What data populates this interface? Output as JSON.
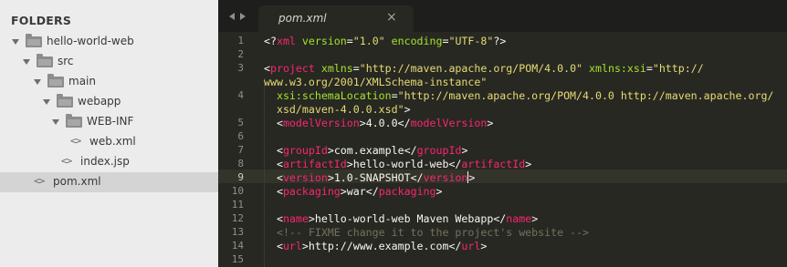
{
  "sidebar": {
    "title": "FOLDERS",
    "items": [
      {
        "label": "hello-world-web",
        "kind": "folder"
      },
      {
        "label": "src",
        "kind": "folder"
      },
      {
        "label": "main",
        "kind": "folder"
      },
      {
        "label": "webapp",
        "kind": "folder"
      },
      {
        "label": "WEB-INF",
        "kind": "folder"
      },
      {
        "label": "web.xml",
        "kind": "file",
        "icon": "<>"
      },
      {
        "label": "index.jsp",
        "kind": "file",
        "icon": "<>"
      },
      {
        "label": "pom.xml",
        "kind": "file",
        "icon": "<>",
        "selected": true
      }
    ]
  },
  "tab": {
    "title": "pom.xml",
    "close": "×"
  },
  "editor": {
    "current_line": 9,
    "line_numbers": [
      "1",
      "2",
      "3",
      "4",
      "5",
      "6",
      "7",
      "8",
      "9",
      "10",
      "11",
      "12",
      "13",
      "14",
      "15"
    ],
    "colors": {
      "tag": "#f92672",
      "attr": "#a6e22e",
      "string": "#e6db74",
      "comment": "#75715e",
      "text": "#f8f8f2",
      "background": "#272822"
    },
    "lines": {
      "l1": {
        "a": "<?",
        "b": "xml",
        "c": " version",
        "d": "=",
        "e": "\"1.0\"",
        "f": " encoding",
        "g": "=",
        "h": "\"UTF-8\"",
        "i": "?>"
      },
      "l3a": {
        "a": "<",
        "b": "project",
        "c": " xmlns",
        "d": "=",
        "e": "\"http://maven.apache.org/POM/4.0.0\"",
        "f": " xmlns:xsi",
        "g": "=",
        "h": "\"http://"
      },
      "l3b": {
        "h": "www.w3.org/2001/XMLSchema-instance\""
      },
      "l4a": {
        "c": "  xsi:schemaLocation",
        "d": "=",
        "e": "\"http://maven.apache.org/POM/4.0.0 http://maven.apache.org/"
      },
      "l4b": {
        "e": "  xsd/maven-4.0.0.xsd\"",
        "f": ">"
      },
      "l5": {
        "a": "  <",
        "b": "modelVersion",
        "c": ">",
        "d": "4.0.0",
        "e": "</",
        "f": "modelVersion",
        "g": ">"
      },
      "l7": {
        "a": "  <",
        "b": "groupId",
        "c": ">",
        "d": "com.example",
        "e": "</",
        "f": "groupId",
        "g": ">"
      },
      "l8": {
        "a": "  <",
        "b": "artifactId",
        "c": ">",
        "d": "hello-world-web",
        "e": "</",
        "f": "artifactId",
        "g": ">"
      },
      "l9": {
        "a": "  <",
        "b": "version",
        "c": ">",
        "d": "1.0-SNAPSHOT",
        "e": "</",
        "f": "version",
        "g": ">"
      },
      "l10": {
        "a": "  <",
        "b": "packaging",
        "c": ">",
        "d": "war",
        "e": "</",
        "f": "packaging",
        "g": ">"
      },
      "l12": {
        "a": "  <",
        "b": "name",
        "c": ">",
        "d": "hello-world-web Maven Webapp",
        "e": "</",
        "f": "name",
        "g": ">"
      },
      "l13": {
        "a": "  <!-- FIXME change it to the project's website -->"
      },
      "l14": {
        "a": "  <",
        "b": "url",
        "c": ">",
        "d": "http://www.example.com",
        "e": "</",
        "f": "url",
        "g": ">"
      }
    }
  }
}
